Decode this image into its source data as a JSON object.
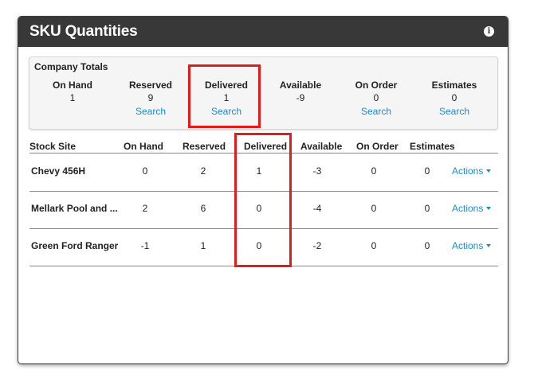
{
  "panel": {
    "title": "SKU Quantities",
    "info_icon": "i"
  },
  "totals": {
    "title": "Company Totals",
    "columns": [
      {
        "label": "On Hand",
        "value": "1",
        "search": ""
      },
      {
        "label": "Reserved",
        "value": "9",
        "search": "Search"
      },
      {
        "label": "Delivered",
        "value": "1",
        "search": "Search"
      },
      {
        "label": "Available",
        "value": "-9",
        "search": ""
      },
      {
        "label": "On Order",
        "value": "0",
        "search": "Search"
      },
      {
        "label": "Estimates",
        "value": "0",
        "search": "Search"
      }
    ]
  },
  "table": {
    "headers": [
      "Stock Site",
      "On Hand",
      "Reserved",
      "Delivered",
      "Available",
      "On Order",
      "Estimates"
    ],
    "rows": [
      {
        "site": "Chevy 456H",
        "on_hand": "0",
        "reserved": "2",
        "delivered": "1",
        "available": "-3",
        "on_order": "0",
        "estimates": "0",
        "action": "Actions"
      },
      {
        "site": "Mellark Pool and ...",
        "on_hand": "2",
        "reserved": "6",
        "delivered": "0",
        "available": "-4",
        "on_order": "0",
        "estimates": "0",
        "action": "Actions"
      },
      {
        "site": "Green Ford Ranger",
        "on_hand": "-1",
        "reserved": "1",
        "delivered": "0",
        "available": "-2",
        "on_order": "0",
        "estimates": "0",
        "action": "Actions"
      }
    ]
  },
  "colors": {
    "header_bg": "#383838",
    "link": "#1a8ad4",
    "highlight": "#e31b1b"
  }
}
